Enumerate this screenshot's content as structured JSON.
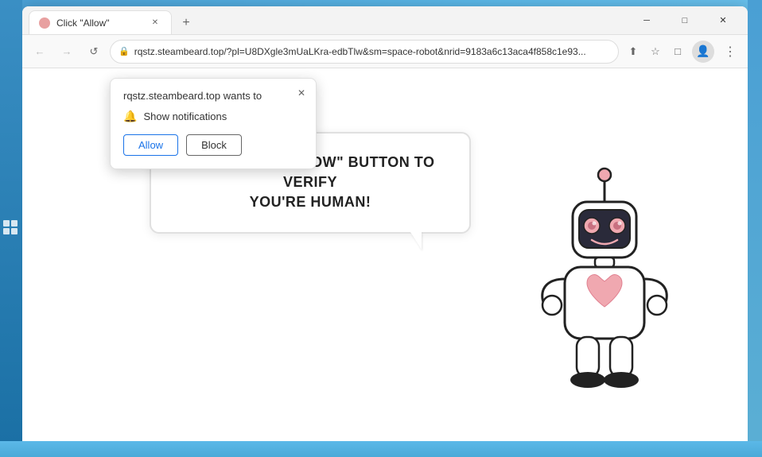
{
  "window": {
    "title": "Click \"Allow\"",
    "favicon": "robot-icon"
  },
  "titlebar": {
    "minimize_label": "─",
    "maximize_label": "□",
    "close_label": "✕",
    "new_tab_label": "+"
  },
  "addressbar": {
    "back_label": "←",
    "forward_label": "→",
    "refresh_label": "↺",
    "url": "rqstz.steambeard.top/?pl=U8DXgle3mUaLKra-edbTlw&sm=space-robot&nrid=9183a6c13aca4f858c1e93...",
    "share_label": "⬆",
    "bookmark_label": "☆",
    "extensions_label": "□",
    "profile_label": "👤",
    "menu_label": "⋮"
  },
  "notification_popup": {
    "title": "rqstz.steambeard.top wants to",
    "close_label": "✕",
    "notification_item": "Show notifications",
    "allow_label": "Allow",
    "block_label": "Block"
  },
  "page_content": {
    "bubble_text_line1": "PRESS THE \"ALLOW\" BUTTON TO VERIFY",
    "bubble_text_line2": "YOU'RE HUMAN!"
  },
  "colors": {
    "allow_button": "#1a73e8",
    "bubble_border": "#e0e0e0",
    "robot_pink": "#f0a8b0",
    "robot_outline": "#222"
  }
}
